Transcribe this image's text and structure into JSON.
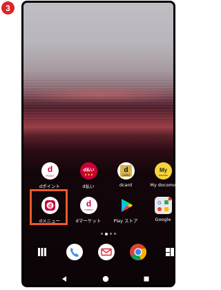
{
  "step_number": "3",
  "home": {
    "row1": [
      {
        "label": "dポイント",
        "icon": "d-point-icon",
        "badge": "POINT"
      },
      {
        "label": "d払い",
        "icon": "d-barai-icon",
        "badge": "d払い"
      },
      {
        "label": "dcard",
        "icon": "dcard-icon",
        "badge": "CARD"
      },
      {
        "label": "My docomo",
        "icon": "my-docomo-icon",
        "badge": "My"
      }
    ],
    "row2": [
      {
        "label": "dメニュー",
        "icon": "d-menu-icon",
        "highlighted": true
      },
      {
        "label": "dマーケット",
        "icon": "d-market-icon",
        "badge": "market"
      },
      {
        "label": "Play ストア",
        "icon": "play-store-icon"
      },
      {
        "label": "Google",
        "icon": "google-folder-icon"
      }
    ],
    "page_indicator": {
      "pages": 4,
      "current": 1
    }
  },
  "dock": [
    "app-drawer-icon",
    "phone-icon",
    "mail-icon",
    "chrome-icon",
    "widget-icon"
  ],
  "nav": [
    "back-button",
    "home-button",
    "recents-button"
  ],
  "colors": {
    "highlight": "#f0592a",
    "docomo_red": "#cc0033",
    "step_badge": "#d9262b"
  }
}
